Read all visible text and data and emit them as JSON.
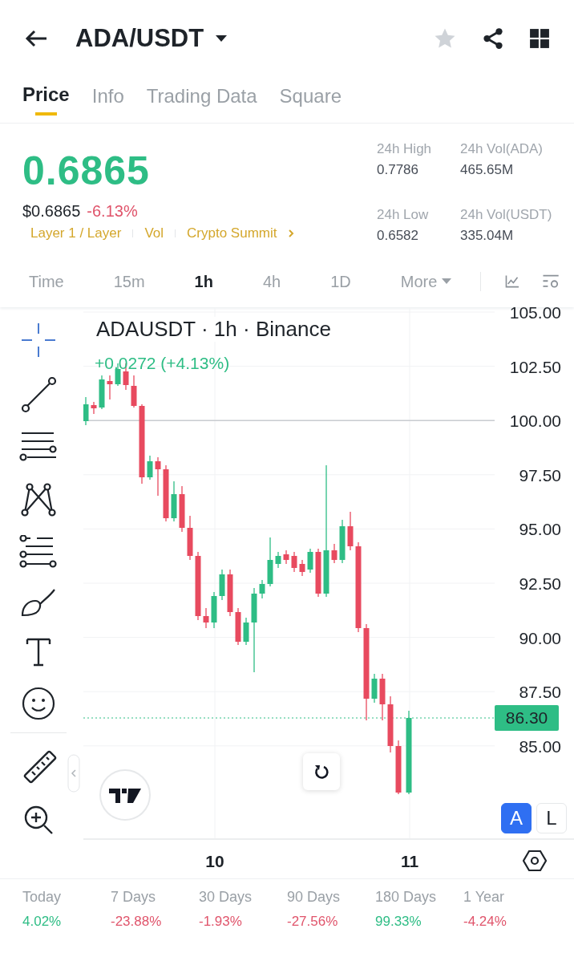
{
  "header": {
    "pair": "ADA/USDT",
    "favorite": false
  },
  "tabs": [
    {
      "label": "Price",
      "selected": true
    },
    {
      "label": "Info",
      "selected": false
    },
    {
      "label": "Trading Data",
      "selected": false
    },
    {
      "label": "Square",
      "selected": false
    }
  ],
  "price": {
    "last": "0.6865",
    "usd": "$0.6865",
    "change": "-6.13%",
    "tags": [
      "Layer 1 / Layer",
      "Vol",
      "Crypto Summit"
    ]
  },
  "stats": [
    {
      "label": "24h High",
      "value": "0.7786"
    },
    {
      "label": "24h Vol(ADA)",
      "value": "465.65M"
    },
    {
      "label": "24h Low",
      "value": "0.6582"
    },
    {
      "label": "24h Vol(USDT)",
      "value": "335.04M"
    }
  ],
  "timeframes": [
    {
      "label": "Time",
      "selected": false
    },
    {
      "label": "15m",
      "selected": false
    },
    {
      "label": "1h",
      "selected": true
    },
    {
      "label": "4h",
      "selected": false
    },
    {
      "label": "1D",
      "selected": false
    }
  ],
  "more": "More",
  "chart": {
    "title": "ADAUSDT · 1h · Binance",
    "change": "+0.0272 (+4.13%)",
    "yticks": [
      "105.00",
      "102.50",
      "100.00",
      "97.50",
      "95.00",
      "92.50",
      "90.00",
      "87.50",
      "85.00"
    ],
    "xticks": [
      "10",
      "11"
    ],
    "last_price": "86.30",
    "scale_modes": [
      {
        "label": "A",
        "selected": true
      },
      {
        "label": "L",
        "selected": false
      }
    ]
  },
  "performance": [
    {
      "label": "Today",
      "value": "4.02%",
      "color": "#2ebd85"
    },
    {
      "label": "7 Days",
      "value": "-23.88%",
      "color": "#e0546b"
    },
    {
      "label": "30 Days",
      "value": "-1.93%",
      "color": "#e0546b"
    },
    {
      "label": "90 Days",
      "value": "-27.56%",
      "color": "#e0546b"
    },
    {
      "label": "180 Days",
      "value": "99.33%",
      "color": "#2ebd85"
    },
    {
      "label": "1 Year",
      "value": "-4.24%",
      "color": "#e0546b"
    }
  ]
}
